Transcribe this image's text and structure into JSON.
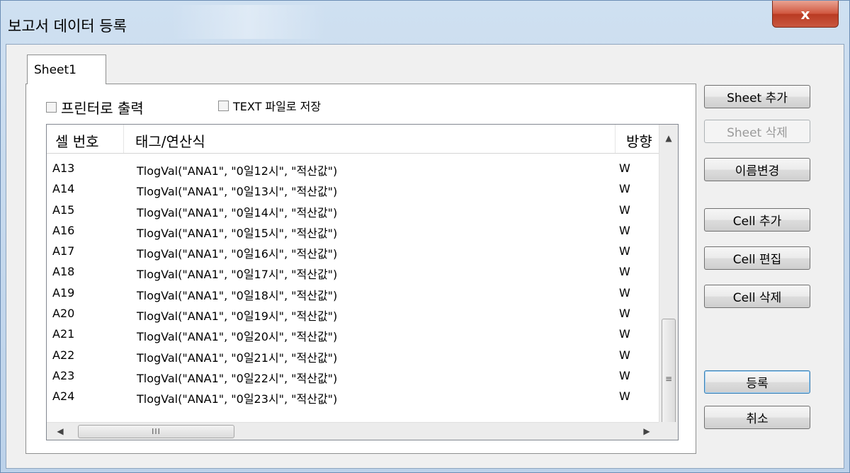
{
  "window": {
    "title": "보고서 데이터 등록",
    "close_glyph": "x"
  },
  "tabs": [
    {
      "label": "Sheet1"
    }
  ],
  "options": {
    "print_label": "프린터로 출력",
    "save_text_label": "TEXT 파일로 저장"
  },
  "list": {
    "headers": {
      "cell": "셀 번호",
      "tag": "태그/연산식",
      "direction": "방향"
    },
    "rows": [
      {
        "cell": "A13",
        "expr": "TlogVal(\"ANA1\", \"0일12시\", \"적산값\")",
        "dir": "W"
      },
      {
        "cell": "A14",
        "expr": "TlogVal(\"ANA1\", \"0일13시\", \"적산값\")",
        "dir": "W"
      },
      {
        "cell": "A15",
        "expr": "TlogVal(\"ANA1\", \"0일14시\", \"적산값\")",
        "dir": "W"
      },
      {
        "cell": "A16",
        "expr": "TlogVal(\"ANA1\", \"0일15시\", \"적산값\")",
        "dir": "W"
      },
      {
        "cell": "A17",
        "expr": "TlogVal(\"ANA1\", \"0일16시\", \"적산값\")",
        "dir": "W"
      },
      {
        "cell": "A18",
        "expr": "TlogVal(\"ANA1\", \"0일17시\", \"적산값\")",
        "dir": "W"
      },
      {
        "cell": "A19",
        "expr": "TlogVal(\"ANA1\", \"0일18시\", \"적산값\")",
        "dir": "W"
      },
      {
        "cell": "A20",
        "expr": "TlogVal(\"ANA1\", \"0일19시\", \"적산값\")",
        "dir": "W"
      },
      {
        "cell": "A21",
        "expr": "TlogVal(\"ANA1\", \"0일20시\", \"적산값\")",
        "dir": "W"
      },
      {
        "cell": "A22",
        "expr": "TlogVal(\"ANA1\", \"0일21시\", \"적산값\")",
        "dir": "W"
      },
      {
        "cell": "A23",
        "expr": "TlogVal(\"ANA1\", \"0일22시\", \"적산값\")",
        "dir": "W"
      },
      {
        "cell": "A24",
        "expr": "TlogVal(\"ANA1\", \"0일23시\", \"적산값\")",
        "dir": "W"
      }
    ],
    "scroll": {
      "up": "▲",
      "down": "▼",
      "left": "◀",
      "right": "▶",
      "v_grip": "≡",
      "h_grip": "III"
    }
  },
  "buttons": {
    "add_sheet": "Sheet 추가",
    "delete_sheet": "Sheet 삭제",
    "rename": "이름변경",
    "add_cell": "Cell 추가",
    "edit_cell": "Cell 편집",
    "delete_cell": "Cell 삭제",
    "register": "등록",
    "cancel": "취소"
  }
}
